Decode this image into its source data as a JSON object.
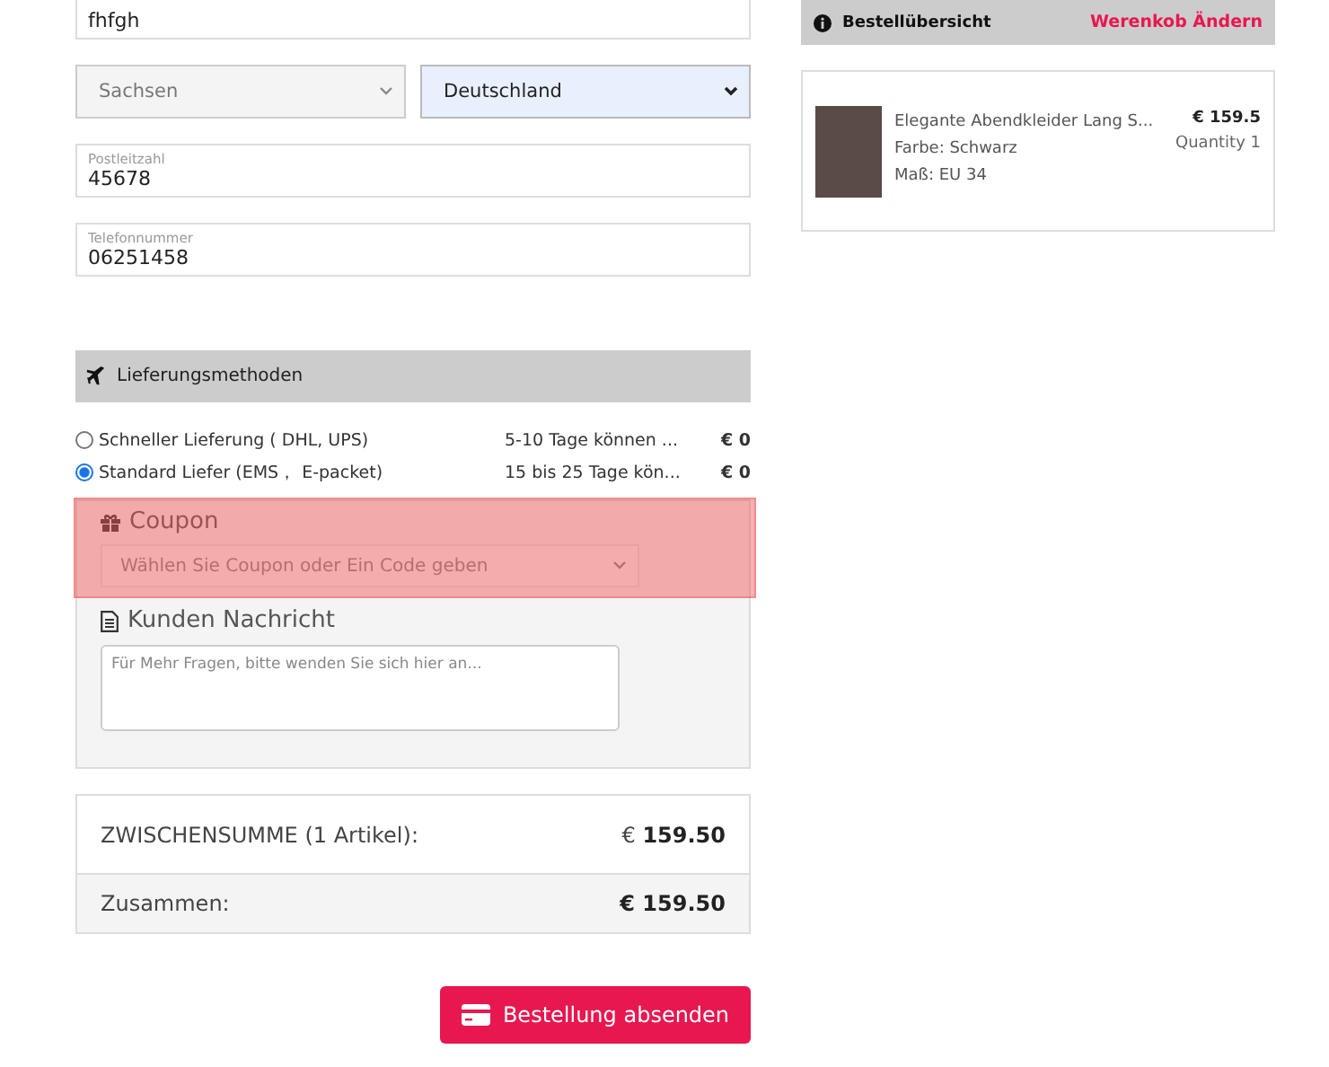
{
  "address": {
    "city_value": "fhfgh",
    "state_select": "Sachsen",
    "country_select": "Deutschland",
    "postal_field": {
      "label": "Postleitzahl",
      "value": "45678"
    },
    "phone_field": {
      "label": "Telefonnummer",
      "value": "06251458"
    }
  },
  "shipping": {
    "title": "Lieferungsmethoden",
    "options": [
      {
        "name": "Schneller Lieferung ( DHL, UPS)",
        "time": "5-10 Tage können ...",
        "price": "€ 0",
        "selected": false
      },
      {
        "name": "Standard Liefer (EMS， E-packet)",
        "time": "15 bis 25 Tage kön...",
        "price": "€ 0",
        "selected": true
      }
    ]
  },
  "coupon": {
    "title": "Coupon",
    "select": "Wählen Sie Coupon oder Ein Code geben",
    "highlighted": true
  },
  "message": {
    "title": "Kunden Nachricht",
    "placeholder": "Für Mehr Fragen, bitte wenden Sie sich hier an..."
  },
  "totals": [
    {
      "label": "ZWISCHENSUMME (1 Artikel):",
      "value": "159.50",
      "currency": "€"
    },
    {
      "label": "Zusammen:",
      "value": "€ 159.50"
    }
  ],
  "submit_button": "Bestellung absenden",
  "summary": {
    "title": "Bestellübersicht",
    "edit_link": "Werenkob Ändern",
    "item": {
      "name": "Elegante Abendkleider Lang S...",
      "colour_label": "Farbe: Schwarz",
      "size": "Maß: EU 34",
      "price": "€ 159.5",
      "quantity": "Quantity 1"
    }
  }
}
